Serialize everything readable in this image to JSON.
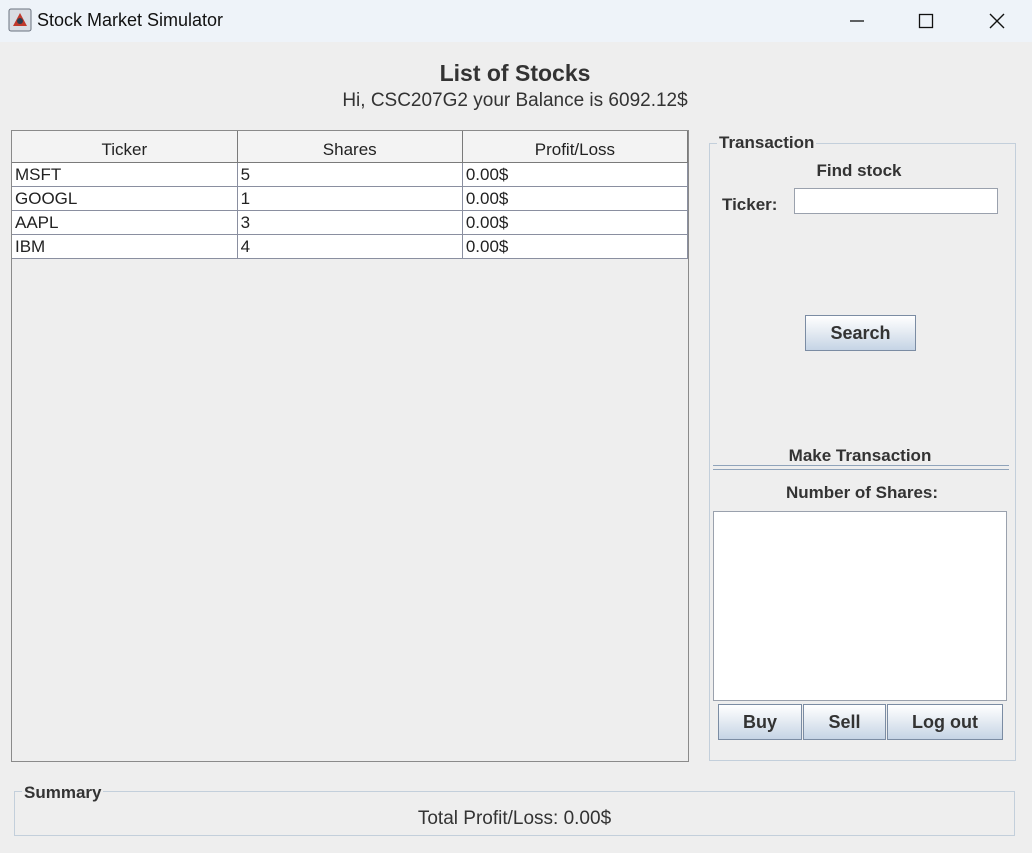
{
  "window": {
    "title": "Stock Market Simulator"
  },
  "header": {
    "title": "List of Stocks",
    "greeting": "Hi, CSC207G2 your Balance is 6092.12$"
  },
  "table": {
    "columns": [
      "Ticker",
      "Shares",
      "Profit/Loss"
    ],
    "rows": [
      [
        "MSFT",
        "5",
        "0.00$"
      ],
      [
        "GOOGL",
        "1",
        "0.00$"
      ],
      [
        "AAPL",
        "3",
        "0.00$"
      ],
      [
        "IBM",
        "4",
        "0.00$"
      ]
    ]
  },
  "transaction": {
    "legend": "Transaction",
    "find_title": "Find stock",
    "ticker_label": "Ticker:",
    "ticker_value": "",
    "search_label": "Search",
    "make_title": "Make Transaction",
    "shares_label": "Number of Shares:",
    "shares_value": "",
    "buy_label": "Buy",
    "sell_label": "Sell",
    "logout_label": "Log out"
  },
  "summary": {
    "legend": "Summary",
    "total": "Total Profit/Loss: 0.00$"
  }
}
